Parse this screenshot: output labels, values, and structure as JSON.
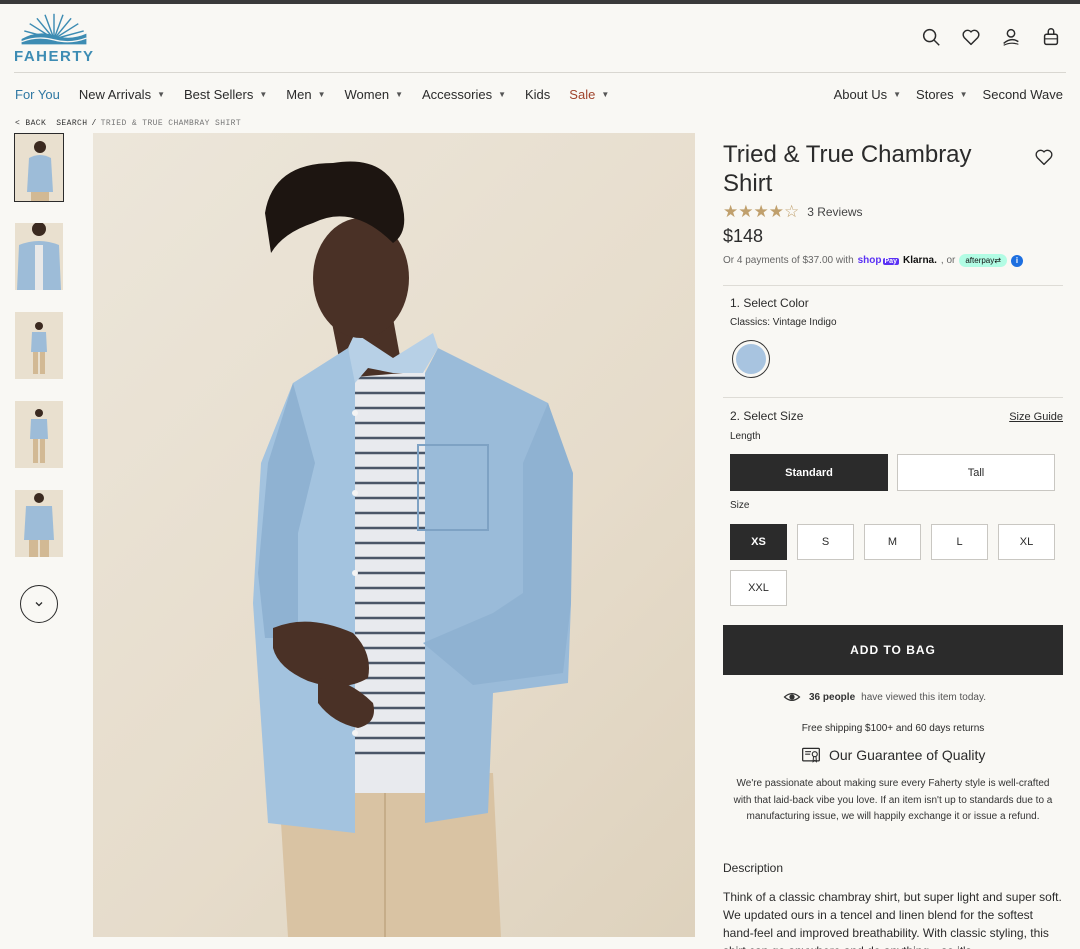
{
  "brand": {
    "name": "FAHERTY",
    "accent": "#3d8cb3"
  },
  "header": {
    "icons": [
      "search-icon",
      "heart-icon",
      "account-icon",
      "bag-icon"
    ]
  },
  "nav": {
    "left": [
      {
        "label": "For You",
        "dropdown": false
      },
      {
        "label": "New Arrivals",
        "dropdown": true
      },
      {
        "label": "Best Sellers",
        "dropdown": true
      },
      {
        "label": "Men",
        "dropdown": true
      },
      {
        "label": "Women",
        "dropdown": true
      },
      {
        "label": "Accessories",
        "dropdown": true
      },
      {
        "label": "Kids",
        "dropdown": false
      },
      {
        "label": "Sale",
        "dropdown": true
      }
    ],
    "right": [
      {
        "label": "About Us",
        "dropdown": true
      },
      {
        "label": "Stores",
        "dropdown": true
      },
      {
        "label": "Second Wave",
        "dropdown": false
      }
    ]
  },
  "breadcrumb": {
    "back": "< BACK",
    "search": "SEARCH",
    "sep": "/",
    "current": "TRIED & TRUE CHAMBRAY SHIRT"
  },
  "product": {
    "title": "Tried & True Chambray Shirt",
    "rating": 4.5,
    "stars": "★★★★☆",
    "reviews": "3 Reviews",
    "price": "$148",
    "payments_prefix": "Or 4 payments of $37.00 with",
    "shop_pay": "shop",
    "shop_pay_box": "Pay",
    "klarna": "Klarna.",
    "or": ", or",
    "afterpay": "afterpay⇄",
    "info": "i"
  },
  "color": {
    "heading": "1. Select Color",
    "selected": "Classics: Vintage Indigo",
    "swatch_color": "#a8c4e0"
  },
  "size": {
    "heading": "2. Select Size",
    "size_guide": "Size Guide",
    "length_label": "Length",
    "lengths": [
      "Standard",
      "Tall"
    ],
    "selected_length": "Standard",
    "size_label": "Size",
    "sizes": [
      "XS",
      "S",
      "M",
      "L",
      "XL",
      "XXL"
    ],
    "selected_size": "XS"
  },
  "cta": {
    "add_to_bag": "ADD TO BAG"
  },
  "viewers": {
    "count": "36 people",
    "text": "have viewed this item today."
  },
  "shipping": "Free shipping $100+ and 60 days returns",
  "guarantee": {
    "title": "Our Guarantee of Quality",
    "text": "We're passionate about making sure every Faherty style is well-crafted with that laid-back vibe you love. If an item isn't up to standards due to a manufacturing issue, we will happily exchange it or issue a refund."
  },
  "description": {
    "title": "Description",
    "body": "Think of a classic chambray shirt, but super light and super soft. We updated ours in a tencel and linen blend for the softest hand-feel and improved breathability. With classic styling, this shirt can go anywhere and do anything—so it's"
  }
}
